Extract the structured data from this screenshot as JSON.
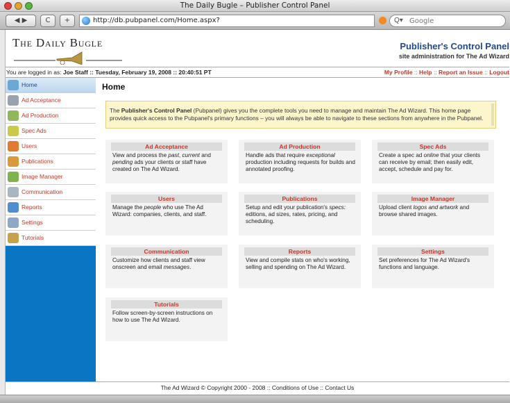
{
  "window": {
    "title": "The Daily Bugle – Publisher Control Panel"
  },
  "browser": {
    "back_forward": "◀ ▶",
    "reload": "C",
    "add": "+",
    "url": "http://db.pubpanel.com/Home.aspx?",
    "search_placeholder": "Google",
    "search_icon_glyph": "Q▾"
  },
  "header": {
    "logo": "The Daily Bugle",
    "title": "Publisher's Control Panel",
    "subtitle": "site administration for The Ad Wizard"
  },
  "info": {
    "prefix": "You are logged in as:",
    "user": "Joe Staff",
    "datetime": ":: Tuesday, February 19, 2008 :: 20:40:51 PT",
    "links": [
      "My Profile",
      "Help",
      "Report an Issue",
      "Logout"
    ],
    "link_sep": "::"
  },
  "sidebar": {
    "items": [
      {
        "label": "Home",
        "icon": "home-icon",
        "color": "#6aa9d6",
        "active": true
      },
      {
        "label": "Ad Acceptance",
        "icon": "ad-acceptance-icon",
        "color": "#9aa3ad"
      },
      {
        "label": "Ad Production",
        "icon": "ad-production-icon",
        "color": "#8fb85a"
      },
      {
        "label": "Spec Ads",
        "icon": "spec-ads-icon",
        "color": "#c9c94a"
      },
      {
        "label": "Users",
        "icon": "users-icon",
        "color": "#e07b2f"
      },
      {
        "label": "Publications",
        "icon": "publications-icon",
        "color": "#d99a3c"
      },
      {
        "label": "Image Manager",
        "icon": "image-manager-icon",
        "color": "#7fb34d"
      },
      {
        "label": "Communication",
        "icon": "communication-icon",
        "color": "#a9b6c2"
      },
      {
        "label": "Reports",
        "icon": "reports-icon",
        "color": "#4f8fd0"
      },
      {
        "label": "Settings",
        "icon": "settings-icon",
        "color": "#8fa8c7"
      },
      {
        "label": "Tutorials",
        "icon": "tutorials-icon",
        "color": "#c8a24a"
      }
    ]
  },
  "main": {
    "title": "Home",
    "intro": {
      "pre": "The ",
      "bold": "Publisher's Control Panel",
      "post": " (Pubpanel) gives you the complete tools you need to manage and maintain The Ad Wizard. This home page provides quick access to the Pubpanel's primary functions – you will always be able to navigate to these sections from anywhere in the Pubpanel."
    },
    "cards": [
      {
        "title": "Ad Acceptance",
        "desc": "View and process the past, current and pending ads your clients or staff have created on The Ad Wizard."
      },
      {
        "title": "Ad Production",
        "desc": "Handle ads that require exceptional production including requests for builds and annotated proofing."
      },
      {
        "title": "Spec Ads",
        "desc": "Create a spec ad online that your clients can receive by email; then easily edit, accept, schedule and pay for."
      },
      {
        "title": "Users",
        "desc": "Manage the people who use The Ad Wizard: companies, clients, and staff."
      },
      {
        "title": "Publications",
        "desc": "Setup and edit your publication's specs: editions, ad sizes, rates, pricing, and scheduling."
      },
      {
        "title": "Image Manager",
        "desc": "Upload client logos and artwork and browse shared images."
      },
      {
        "title": "Communication",
        "desc": "Customize how clients and staff view onscreen and email messages."
      },
      {
        "title": "Reports",
        "desc": "View and compile stats on who's working, selling and spending on The Ad Wizard."
      },
      {
        "title": "Settings",
        "desc": "Set preferences for The Ad Wizard's functions and language."
      },
      {
        "title": "Tutorials",
        "desc": "Follow screen-by-screen instructions on how to use The Ad Wizard."
      }
    ]
  },
  "footer": {
    "text": "The Ad Wizard © Copyright 2000 - 2008 :: Conditions of Use :: Contact Us"
  },
  "colors": {
    "accent_red": "#c0392b",
    "sidebar_blue": "#0a75c2",
    "title_blue": "#244a85",
    "intro_bg": "#fdf6cd"
  }
}
